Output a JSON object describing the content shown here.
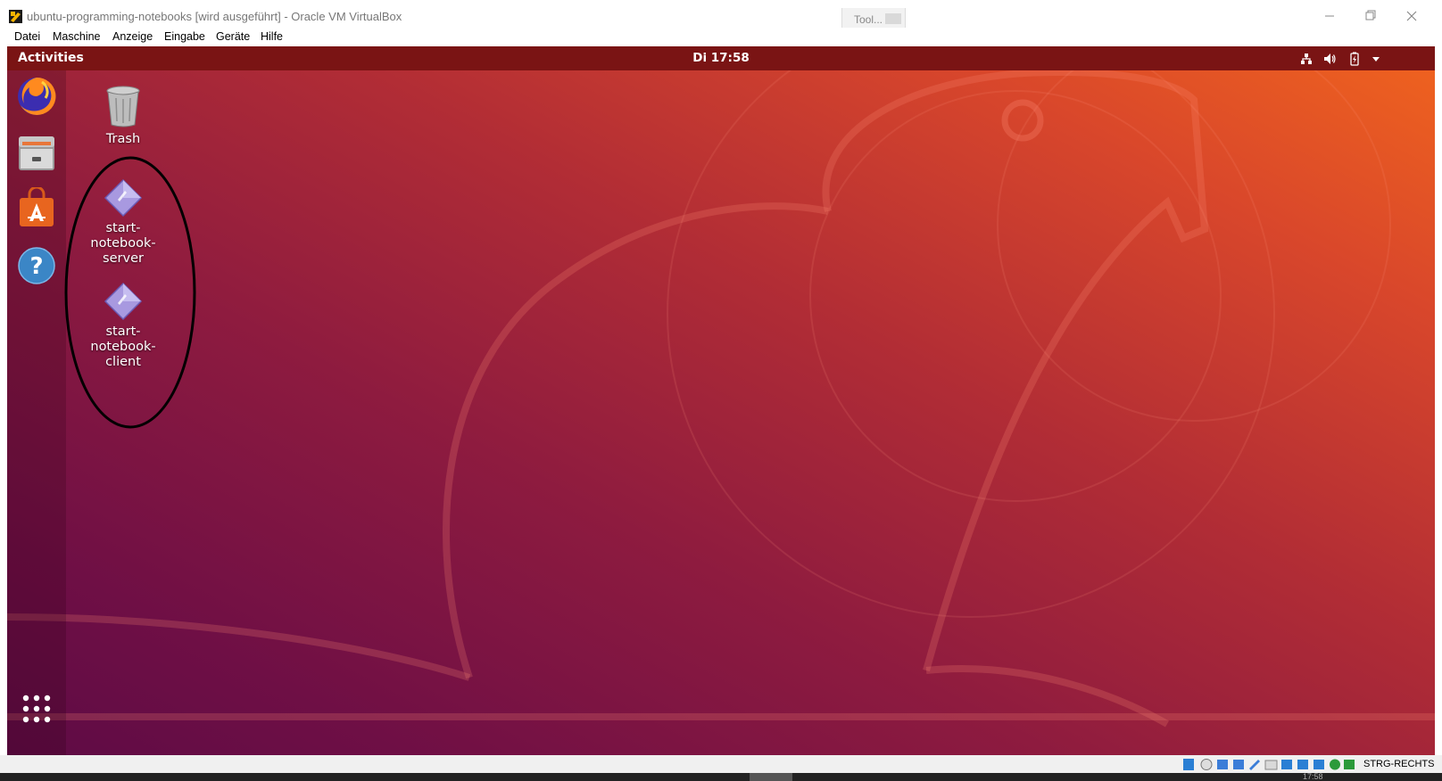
{
  "window": {
    "title": "ubuntu-programming-notebooks [wird ausgeführt] - Oracle VM VirtualBox",
    "tool_tab_label": "Tool...",
    "menu": [
      "Datei",
      "Maschine",
      "Anzeige",
      "Eingabe",
      "Geräte",
      "Hilfe"
    ]
  },
  "guest": {
    "topbar": {
      "activities": "Activities",
      "clock": "Di 17:58",
      "tray_icons": [
        "network-icon",
        "volume-icon",
        "battery-icon",
        "system-menu-arrow-icon"
      ]
    },
    "dock": {
      "apps": [
        "firefox-icon",
        "files-icon",
        "software-store-icon",
        "help-icon"
      ],
      "show_apps": "show-applications-icon"
    },
    "desktop_icons": [
      {
        "label": "Trash",
        "icon": "trash-icon"
      },
      {
        "label": "start-\nnotebook-\nserver",
        "icon": "launcher-script-icon"
      },
      {
        "label": "start-\nnotebook-\nclient",
        "icon": "launcher-script-icon"
      }
    ],
    "annotation": "hand-drawn ellipse around launchers"
  },
  "statusbar": {
    "host_key": "STRG-RECHTS"
  },
  "taskbar": {
    "clock_partial": "17:58"
  },
  "colors": {
    "topbar": "#7a1414",
    "wallpaper_orange": "#f0641e",
    "wallpaper_purple": "#5e0b45",
    "annotation_stroke": "#000000"
  }
}
